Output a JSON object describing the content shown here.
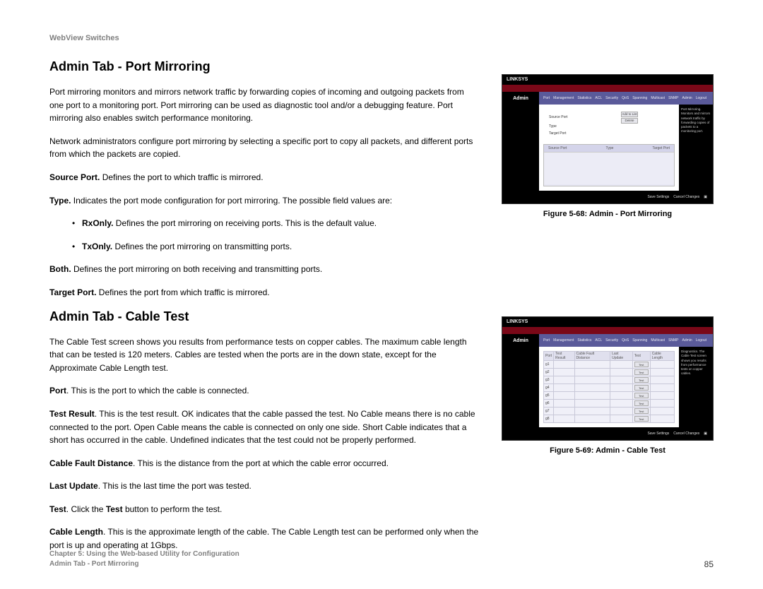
{
  "header": {
    "product": "WebView Switches"
  },
  "sections": {
    "port_mirroring": {
      "title": "Admin Tab - Port Mirroring",
      "p1": "Port mirroring monitors and mirrors network traffic by forwarding copies of incoming and outgoing packets from one port to a monitoring port. Port mirroring can be used as diagnostic tool and/or a debugging feature. Port mirroring also enables switch performance monitoring.",
      "p2": "Network administrators configure port mirroring by selecting a specific port to copy all packets, and different ports from which the packets are copied.",
      "source_port_b": "Source Port.",
      "source_port_t": " Defines the port to which traffic is mirrored.",
      "type_b": "Type.",
      "type_t": " Indicates the port mode configuration for port mirroring. The possible field values are:",
      "li1_b": "RxOnly.",
      "li1_t": " Defines the port mirroring on receiving ports. This is the default value.",
      "li2_b": "TxOnly.",
      "li2_t": " Defines the port mirroring on transmitting ports.",
      "both_b": "Both.",
      "both_t": " Defines the port mirroring on both receiving and transmitting ports.",
      "target_b": "Target Port.",
      "target_t": " Defines the port from which traffic is mirrored."
    },
    "cable_test": {
      "title": "Admin Tab - Cable Test",
      "p1": "The Cable Test screen shows you results from performance tests on copper cables. The maximum cable length that can be tested is 120 meters. Cables are tested when the ports are in the down state, except for the Approximate Cable Length test.",
      "port_b": "Port",
      "port_t": ". This is the port to which the cable is connected.",
      "result_b": "Test Result",
      "result_t": ". This is the test result. OK indicates that the cable passed the test. No Cable means there is no cable connected to the port. Open Cable means the cable is connected on only one side. Short Cable indicates that a short has occurred in the cable. Undefined indicates that the test could not be properly performed.",
      "fault_b": "Cable Fault Distance",
      "fault_t": ". This is the distance from the port at which the cable error occurred.",
      "last_b": "Last Update",
      "last_t": ". This is the last time the port was tested.",
      "test_b": "Test",
      "test_t1": ". Click the ",
      "test_t2": "Test",
      "test_t3": " button to perform the test.",
      "len_b": "Cable Length",
      "len_t": ". This is the approximate length of the cable. The Cable Length test can be performed only when the port is up and operating at 1Gbps."
    }
  },
  "figures": {
    "f1": {
      "caption": "Figure 5-68: Admin - Port Mirroring",
      "brand": "LINKSYS",
      "admin": "Admin",
      "menu": [
        "Port",
        "Management",
        "Statistics",
        "ACL",
        "Security",
        "QoS",
        "Spanning",
        "Multicast",
        "SNMP",
        "Admin",
        "Logout"
      ],
      "form": {
        "l1": "Source Port",
        "l2": "Type",
        "l3": "Target Port",
        "btn_add": "Add to List",
        "btn_del": "Delete"
      },
      "thead": {
        "a": "Source Port",
        "b": "Type",
        "c": "Target Port"
      }
    },
    "f2": {
      "caption": "Figure 5-69: Admin - Cable Test",
      "brand": "LINKSYS",
      "admin": "Admin",
      "menu": [
        "Port",
        "Management",
        "Statistics",
        "ACL",
        "Security",
        "QoS",
        "Spanning",
        "Multicast",
        "SNMP",
        "Admin",
        "Logout"
      ],
      "cols": [
        "Port",
        "Test Result",
        "Cable Fault Distance",
        "Last Update",
        "Test",
        "Cable Length"
      ],
      "ports": [
        "g1",
        "g2",
        "g3",
        "g4",
        "g5",
        "g6",
        "g7",
        "g8"
      ],
      "test": "Test"
    }
  },
  "footer": {
    "chapter": "Chapter 5: Using the Web-based Utility for Configuration",
    "section": "Admin Tab - Port Mirroring",
    "page": "85"
  }
}
